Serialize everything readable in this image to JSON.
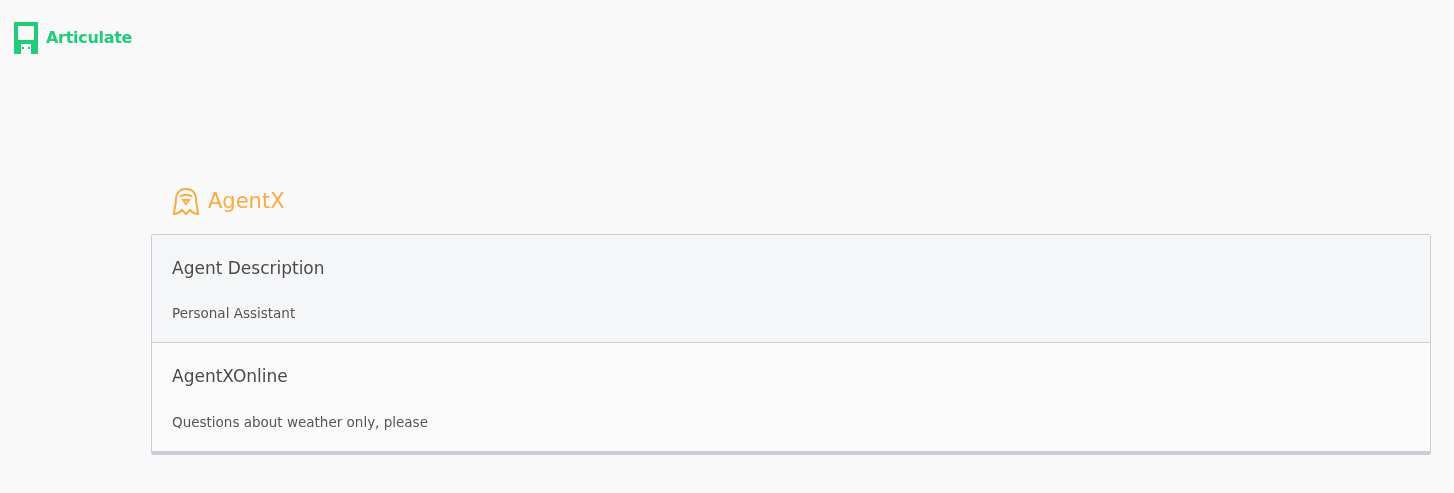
{
  "logo": {
    "text": "Articulate"
  },
  "agent": {
    "name": "AgentX"
  },
  "sections": [
    {
      "title": "Agent Description",
      "text": "Personal Assistant"
    },
    {
      "title": "AgentXOnline",
      "text": "Questions about weather only, please"
    }
  ]
}
